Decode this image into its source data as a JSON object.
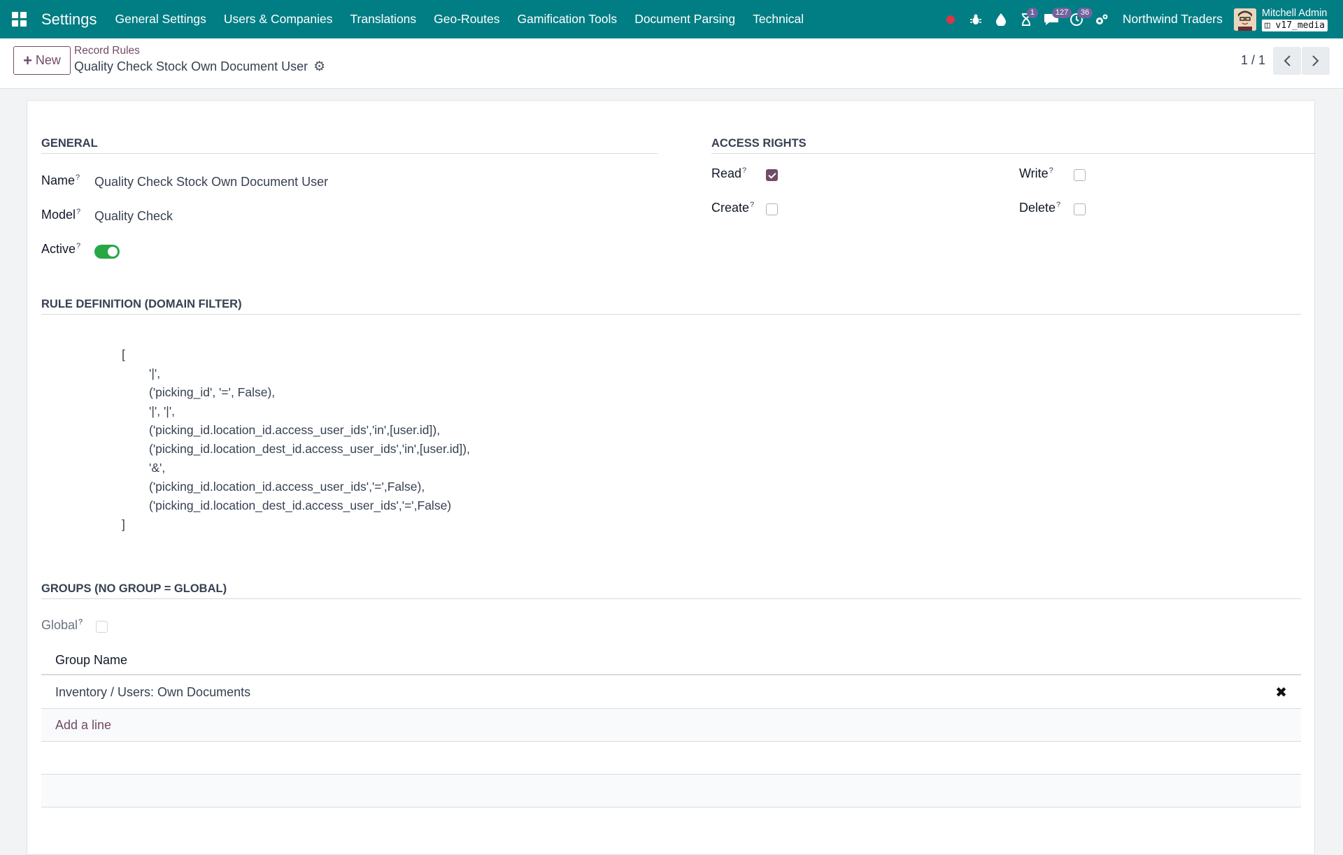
{
  "navbar": {
    "app_name": "Settings",
    "menu": [
      "General Settings",
      "Users & Companies",
      "Translations",
      "Geo-Routes",
      "Gamification Tools",
      "Document Parsing",
      "Technical"
    ],
    "icons": [
      "record-dot-icon",
      "bug-icon",
      "drop-icon",
      "hourglass-icon",
      "chat-icon",
      "clock-icon",
      "gears-icon"
    ],
    "badges": {
      "activities": "1",
      "messages": "127",
      "clock": "36"
    },
    "company": "Northwind Traders",
    "user": "Mitchell Admin",
    "database": "v17_media"
  },
  "control": {
    "new_label": "New",
    "breadcrumb": "Record Rules",
    "record_title": "Quality Check Stock Own Document User",
    "pager": "1 / 1"
  },
  "form": {
    "general": {
      "heading": "General",
      "name_label": "Name",
      "name_value": "Quality Check Stock Own Document User",
      "model_label": "Model",
      "model_value": "Quality Check",
      "active_label": "Active",
      "active": true
    },
    "access": {
      "heading": "Access Rights",
      "read_label": "Read",
      "read": true,
      "write_label": "Write",
      "write": false,
      "create_label": "Create",
      "create": false,
      "delete_label": "Delete",
      "delete": false
    },
    "domain": {
      "heading": "Rule Definition (Domain Filter)",
      "lines": [
        "[",
        "'|',",
        "('picking_id', '=', False),",
        "'|', '|',",
        "('picking_id.location_id.access_user_ids','in',[user.id]),",
        "('picking_id.location_dest_id.access_user_ids','in',[user.id]),",
        "'&',",
        "('picking_id.location_id.access_user_ids','=',False),",
        "('picking_id.location_dest_id.access_user_ids','=',False)",
        "]"
      ]
    },
    "groups": {
      "heading": "Groups (no group = global)",
      "global_label": "Global",
      "global": false,
      "column_header": "Group Name",
      "rows": [
        "Inventory / Users: Own Documents"
      ],
      "add_line": "Add a line"
    }
  },
  "colors": {
    "navbar": "#017e84",
    "primary": "#714b67",
    "toggle_on": "#28a745",
    "badge": "#71639e"
  }
}
